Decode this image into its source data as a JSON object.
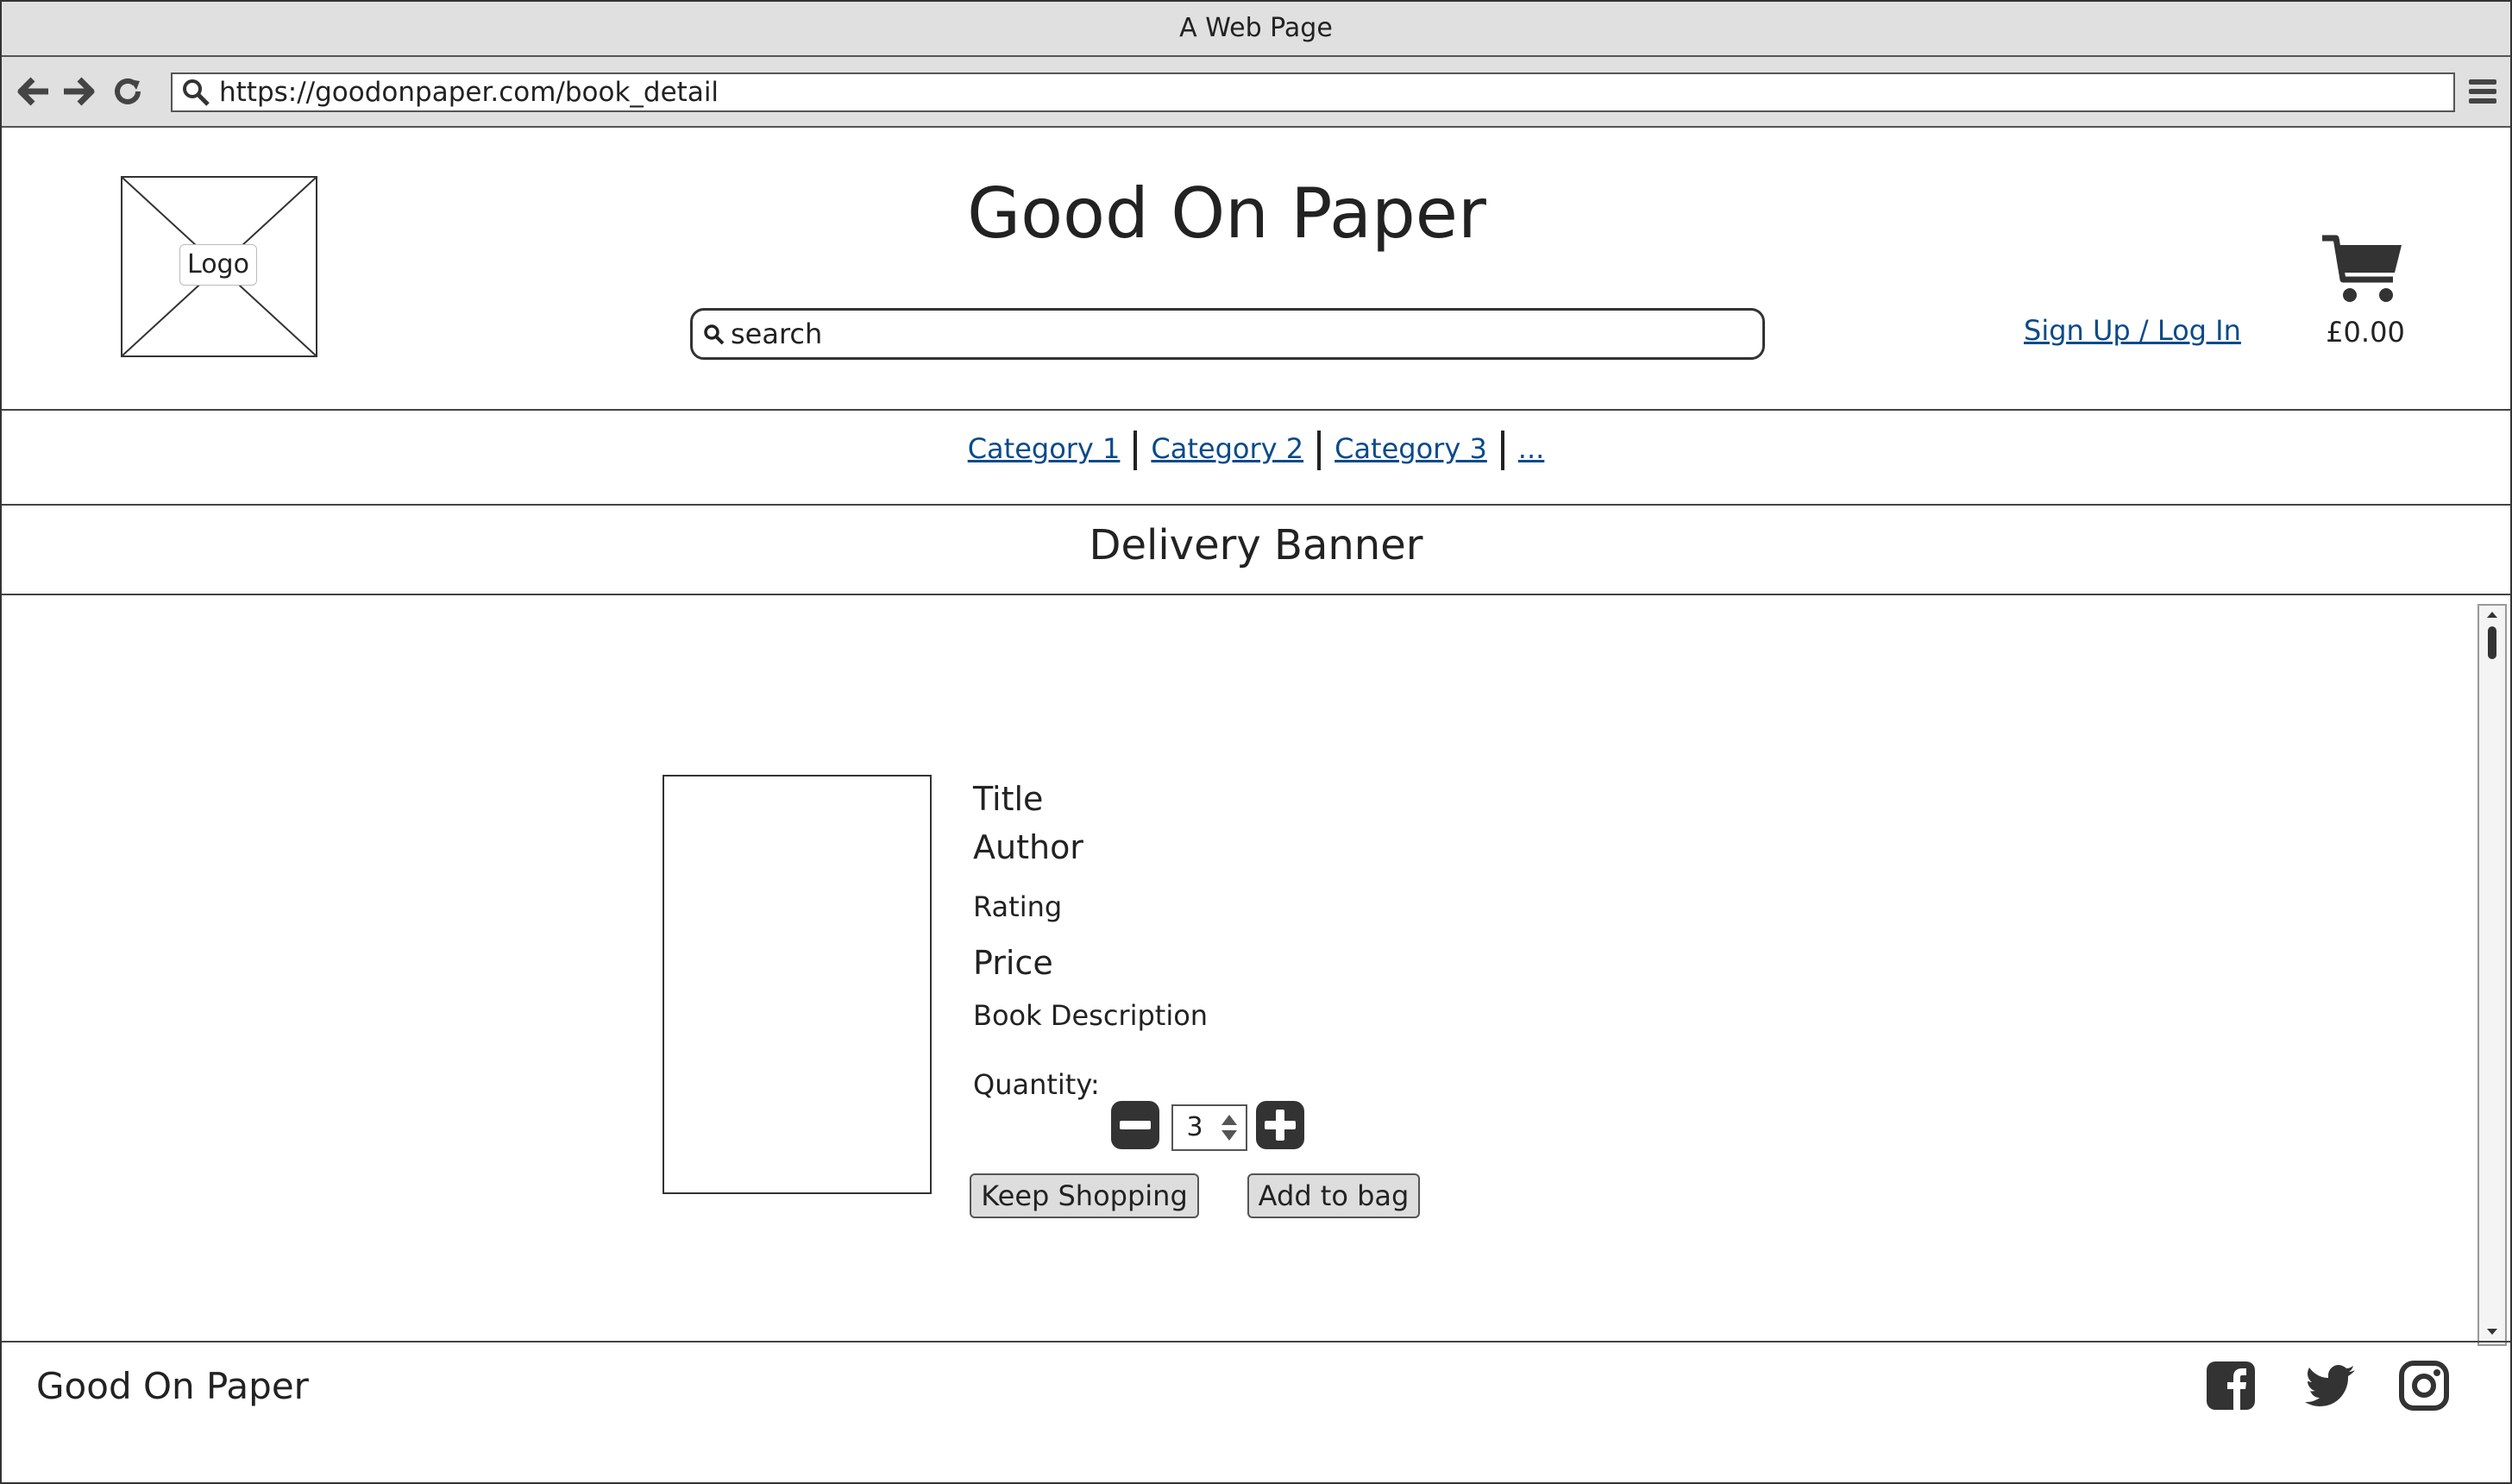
{
  "window": {
    "title": "A Web Page"
  },
  "browser": {
    "url": "https://goodonpaper.com/book_detail"
  },
  "header": {
    "logo_label": "Logo",
    "site_title": "Good On Paper",
    "search_placeholder": "search",
    "auth_link": "Sign Up / Log In",
    "cart_total": "£0.00"
  },
  "categories": [
    "Category 1",
    "Category 2",
    "Category 3",
    "..."
  ],
  "banner": {
    "text": "Delivery Banner"
  },
  "book": {
    "title": "Title",
    "author": "Author",
    "rating": "Rating",
    "price": "Price",
    "description": "Book Description",
    "quantity_label": "Quantity:",
    "quantity_value": "3",
    "keep_shopping": "Keep Shopping",
    "add_to_bag": "Add to bag"
  },
  "footer": {
    "title": "Good On Paper",
    "social_icons": [
      "facebook-icon",
      "twitter-icon",
      "instagram-icon"
    ]
  },
  "colors": {
    "link": "#0a4a8a",
    "chrome": "#e0e0e0",
    "dark": "#333333"
  }
}
